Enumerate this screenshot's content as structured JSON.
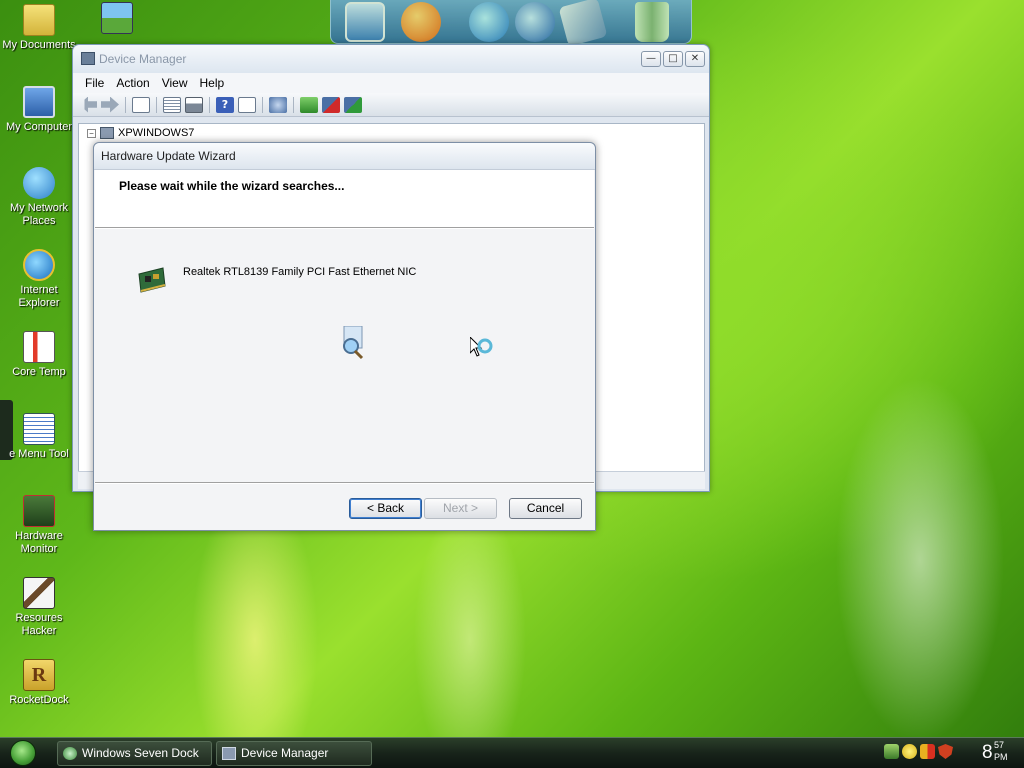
{
  "desktop": {
    "icons": [
      {
        "name": "my-documents",
        "label": "My Documents"
      },
      {
        "name": "my-computer",
        "label": "My Computer"
      },
      {
        "name": "my-network-places",
        "label": "My Network Places"
      },
      {
        "name": "internet-explorer",
        "label": "Internet Explorer"
      },
      {
        "name": "core-temp",
        "label": "Core Temp"
      },
      {
        "name": "menu-tool",
        "label": "e Menu Tool"
      },
      {
        "name": "hardware-monitor",
        "label": "Hardware Monitor"
      },
      {
        "name": "resources-hacker",
        "label": "Resoures Hacker"
      },
      {
        "name": "rocketdock",
        "label": "RocketDock"
      }
    ]
  },
  "device_manager": {
    "title": "Device Manager",
    "menus": [
      "File",
      "Action",
      "View",
      "Help"
    ],
    "tree_root": "XPWINDOWS7"
  },
  "wizard": {
    "title": "Hardware Update Wizard",
    "heading": "Please wait while the wizard searches...",
    "device_name": "Realtek RTL8139 Family PCI Fast Ethernet NIC",
    "back_label": "< Back",
    "next_label": "Next >",
    "cancel_label": "Cancel"
  },
  "taskbar": {
    "tasks": [
      "Windows Seven Dock",
      "Device Manager"
    ],
    "clock_hour": "8",
    "clock_minutes": "57",
    "clock_ampm": "PM"
  },
  "colors": {
    "wallpaper_green": "#5fb81a",
    "taskbar": "#18241a",
    "wizard_bg": "#f3f4f6",
    "default_button_focus": "#3f7fd0"
  }
}
